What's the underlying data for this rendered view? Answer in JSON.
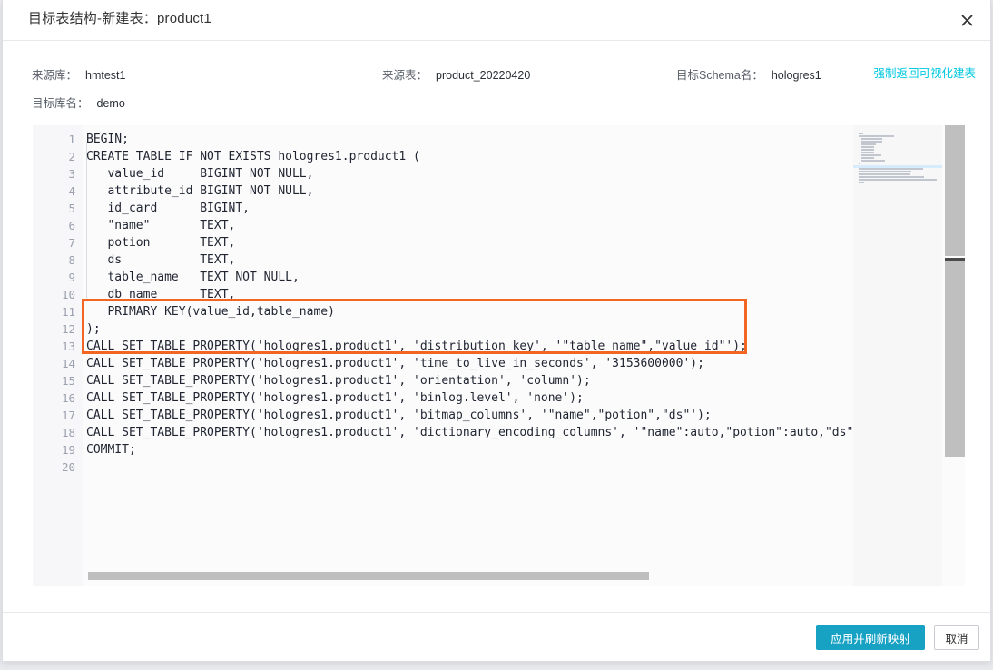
{
  "dialog": {
    "title": "目标表结构-新建表：product1",
    "close_icon": "close-icon"
  },
  "meta": {
    "source_db_label": "来源库：",
    "source_db_value": "hmtest1",
    "target_db_label": "目标库名：",
    "target_db_value": "demo",
    "source_table_label": "来源表：",
    "source_table_value": "product_20220420",
    "target_schema_label": "目标Schema名：",
    "target_schema_value": "hologres1",
    "force_link": "强制返回可视化建表",
    "force_link_color": "#00c8e0"
  },
  "editor": {
    "line_numbers": [
      "1",
      "2",
      "3",
      "4",
      "5",
      "6",
      "7",
      "8",
      "9",
      "10",
      "11",
      "12",
      "13",
      "14",
      "15",
      "16",
      "17",
      "18",
      "19",
      "20"
    ],
    "lines": [
      "BEGIN;",
      "CREATE TABLE IF NOT EXISTS hologres1.product1 (",
      "   value_id     BIGINT NOT NULL,",
      "   attribute_id BIGINT NOT NULL,",
      "   id_card      BIGINT,",
      "   \"name\"       TEXT,",
      "   potion       TEXT,",
      "   ds           TEXT,",
      "   table_name   TEXT NOT NULL,",
      "   db_name      TEXT,",
      "   PRIMARY KEY(value_id,table_name)",
      ");",
      "CALL SET_TABLE_PROPERTY('hologres1.product1', 'distribution_key', '\"table_name\",\"value_id\"');",
      "CALL SET_TABLE_PROPERTY('hologres1.product1', 'time_to_live_in_seconds', '3153600000');",
      "CALL SET_TABLE_PROPERTY('hologres1.product1', 'orientation', 'column');",
      "CALL SET_TABLE_PROPERTY('hologres1.product1', 'binlog.level', 'none');",
      "CALL SET_TABLE_PROPERTY('hologres1.product1', 'bitmap_columns', '\"name\",\"potion\",\"ds\"');",
      "CALL SET_TABLE_PROPERTY('hologres1.product1', 'dictionary_encoding_columns', '\"name\":auto,\"potion\":auto,\"ds\":au",
      "COMMIT;",
      ""
    ],
    "highlight_color": "#f26522",
    "highlight_lines": [
      11,
      12,
      13
    ]
  },
  "footer": {
    "primary_label": "应用并刷新映射",
    "primary_color": "#17a2c4",
    "cancel_label": "取消"
  }
}
